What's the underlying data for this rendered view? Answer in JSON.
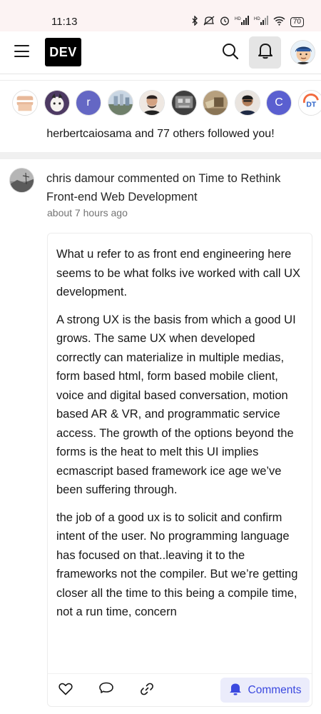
{
  "status_bar": {
    "time": "11:13",
    "battery": "70"
  },
  "header": {
    "logo": "DEV",
    "icons": [
      "menu-icon",
      "search-icon",
      "bell-icon"
    ]
  },
  "followers_card": {
    "message": "herbertcaiosama and 77 others followed you!",
    "avatars": [
      {
        "type": "image",
        "color": "#e8b99a"
      },
      {
        "type": "image",
        "color": "#4d3a63"
      },
      {
        "type": "letter",
        "letter": "r",
        "color": "#6467c4"
      },
      {
        "type": "image",
        "color": "#8fa3b8"
      },
      {
        "type": "image",
        "color": "#b89a86"
      },
      {
        "type": "image",
        "color": "#5a5a5a"
      },
      {
        "type": "image",
        "color": "#a89270"
      },
      {
        "type": "image",
        "color": "#7b6658"
      },
      {
        "type": "letter",
        "letter": "C",
        "color": "#5a5fd0"
      },
      {
        "type": "image",
        "color": "#ffffff"
      }
    ]
  },
  "notification": {
    "actor": "chris damour",
    "action": "commented on",
    "article": "Time to Rethink Front-end Web Development",
    "time": "about 7 hours ago",
    "comment_paragraphs": [
      "What u refer to as front end engineering here seems to be what folks ive worked with call UX development.",
      "A strong UX is the basis from which a good UI grows. The same UX when developed correctly can materialize in multiple medias, form based html, form based mobile client, voice and digital based conversation, motion based AR & VR, and programmatic service access. The growth of the options beyond the forms is the heat to melt this UI implies ecmascript based framework ice age we’ve been suffering through.",
      "the job of a good ux is to solicit and confirm intent of the user. No programming language has focused on that..leaving it to the frameworks not the compiler. But we’re getting closer all the time to this being a compile time, not a run time, concern"
    ],
    "comments_button": "Comments",
    "accent_color": "#3b49df"
  }
}
